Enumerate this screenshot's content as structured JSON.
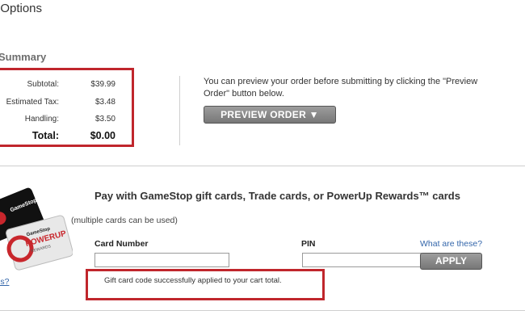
{
  "header": {
    "title": "t Options"
  },
  "summary": {
    "title": "Summary",
    "rows": [
      {
        "label": "Subtotal:",
        "value": "$39.99"
      },
      {
        "label": "Estimated Tax:",
        "value": "$3.48"
      },
      {
        "label": "Handling:",
        "value": "$3.50"
      }
    ],
    "total_label": "Total:",
    "total_value": "$0.00"
  },
  "preview": {
    "text": "You can preview your order before submitting by clicking the \"Preview Order\" button below.",
    "button_label": "PREVIEW ORDER ▼"
  },
  "gift_cards": {
    "title": "Pay with GameStop gift cards, Trade cards, or PowerUp Rewards™ cards",
    "note": "(multiple cards can be used)",
    "card_number_label": "Card Number",
    "card_number_value": "",
    "pin_label": "PIN",
    "pin_value": "",
    "what_link": "What are these?",
    "apply_label": "APPLY",
    "edge_link": "is?",
    "success_message": "Gift card code successfully applied to your cart total.",
    "card_logo_brand": "GameStop",
    "card_logo_text": "POWERUP",
    "card_logo_sub": "REWARDS"
  },
  "colors": {
    "highlight": "#c0262c",
    "button": "#888888",
    "link": "#3366aa"
  }
}
